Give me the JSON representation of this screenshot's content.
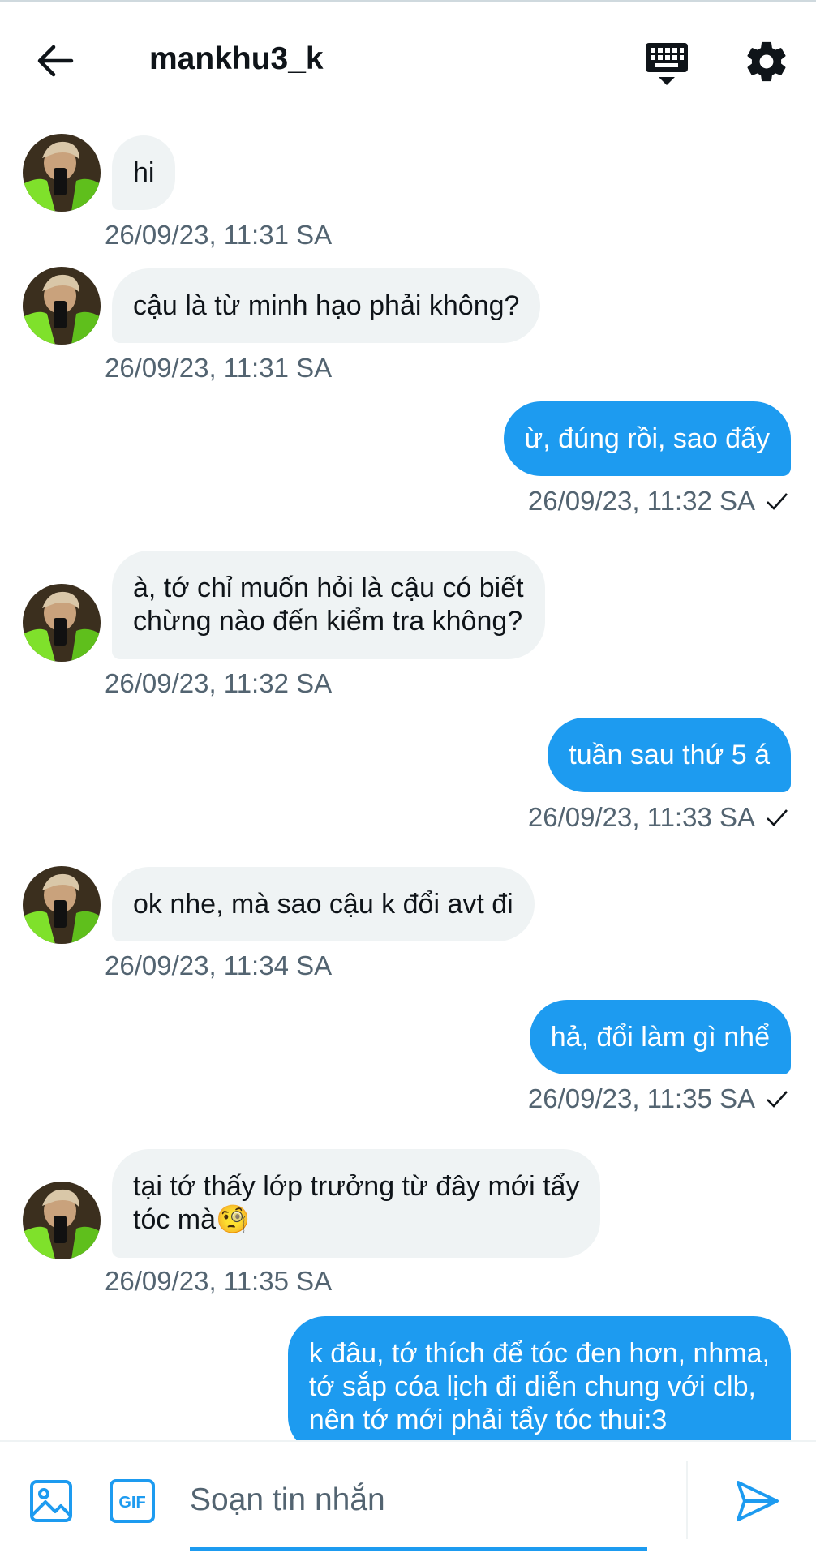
{
  "header": {
    "title": "mankhu3_k",
    "back_icon": "arrow-left-icon",
    "keyboard_icon": "keyboard-icon",
    "settings_icon": "gear-icon"
  },
  "messages": [
    {
      "direction": "in",
      "text": "hi",
      "time": "26/09/23, 11:31 SA"
    },
    {
      "direction": "in",
      "text": "cậu là từ minh hạo phải không?",
      "time": "26/09/23, 11:31 SA"
    },
    {
      "direction": "out",
      "text": "ừ, đúng rồi, sao đấy",
      "time": "26/09/23, 11:32 SA"
    },
    {
      "direction": "in",
      "text": "à, tớ chỉ muốn hỏi là cậu có biết\nchừng nào đến kiểm tra không?",
      "time": "26/09/23, 11:32 SA"
    },
    {
      "direction": "out",
      "text": "tuần sau thứ 5 á",
      "time": "26/09/23, 11:33 SA"
    },
    {
      "direction": "in",
      "text": "ok nhe, mà sao cậu k đổi avt đi",
      "time": "26/09/23, 11:34 SA"
    },
    {
      "direction": "out",
      "text": "hả, đổi làm gì nhể",
      "time": "26/09/23, 11:35 SA"
    },
    {
      "direction": "in",
      "text": "tại tớ thấy lớp trưởng từ đây mới tẩy\ntóc mà🧐",
      "time": "26/09/23, 11:35 SA"
    },
    {
      "direction": "out",
      "text": "k đâu, tớ thích để tóc đen hơn, nhma,\ntớ sắp cóa lịch đi diễn chung với clb,\nnên tớ mới phải tẩy tóc thui:3",
      "time": ""
    }
  ],
  "composer": {
    "placeholder": "Soạn tin nhắn",
    "gif_label": "GIF",
    "image_icon": "image-icon",
    "send_icon": "send-icon"
  },
  "colors": {
    "accent": "#1d9bf0",
    "incoming_bubble": "#eff3f4",
    "timestamp": "#536471"
  }
}
